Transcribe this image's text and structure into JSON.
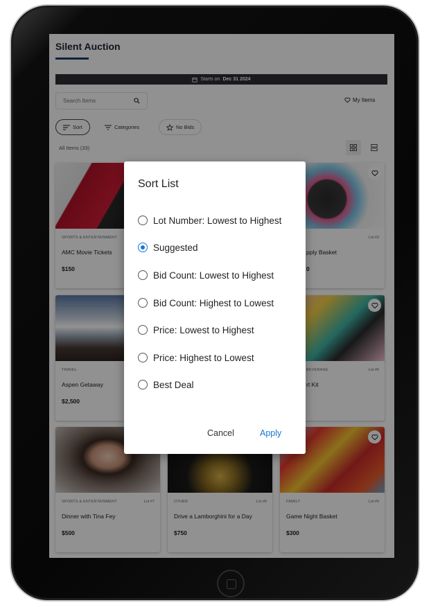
{
  "header": {
    "title": "Silent Auction",
    "banner_prefix": "Starts on",
    "banner_date": "Dec 31 2024"
  },
  "toolbar": {
    "search_placeholder": "Search Items",
    "my_items": "My Items",
    "chips": {
      "sort": "Sort",
      "categories": "Categories",
      "no_bids": "No Bids"
    },
    "count_label": "All Items (33)"
  },
  "items": [
    {
      "category": "SPORTS & ENTERTAINMENT",
      "lot": "",
      "name": "AMC Movie Tickets",
      "price": "$150"
    },
    {
      "category": "",
      "lot": "Lot #3",
      "name": "pply Basket",
      "price": "0"
    },
    {
      "category": "TRAVEL",
      "lot": "",
      "name": "Aspen Getaway",
      "price": "$2,500"
    },
    {
      "category": "BEVERAGE",
      "lot": "Lot #6",
      "name": "rt Kit",
      "price": ""
    },
    {
      "category": "SPORTS & ENTERTAINMENT",
      "lot": "Lot #7",
      "name": "Dinner with Tina Fey",
      "price": "$500"
    },
    {
      "category": "OTHER",
      "lot": "Lot #8",
      "name": "Drive a Lamborghini for a Day",
      "price": "$750"
    },
    {
      "category": "FAMILY",
      "lot": "Lot #9",
      "name": "Game Night Basket",
      "price": "$300"
    }
  ],
  "modal": {
    "title": "Sort List",
    "options": [
      "Lot Number: Lowest to Highest",
      "Suggested",
      "Bid Count: Lowest to Highest",
      "Bid Count: Highest to Lowest",
      "Price: Lowest to Highest",
      "Price: Highest to Lowest",
      "Best Deal"
    ],
    "selected_index": 1,
    "cancel": "Cancel",
    "apply": "Apply"
  },
  "colors": {
    "accent": "#1976d2",
    "title_underline": "#1a3d6d",
    "banner_bg": "#2c2f36"
  },
  "icons": [
    "calendar-icon",
    "search-icon",
    "heart-icon",
    "sort-icon",
    "filter-icon",
    "star-icon",
    "grid-view-icon",
    "list-view-icon"
  ]
}
